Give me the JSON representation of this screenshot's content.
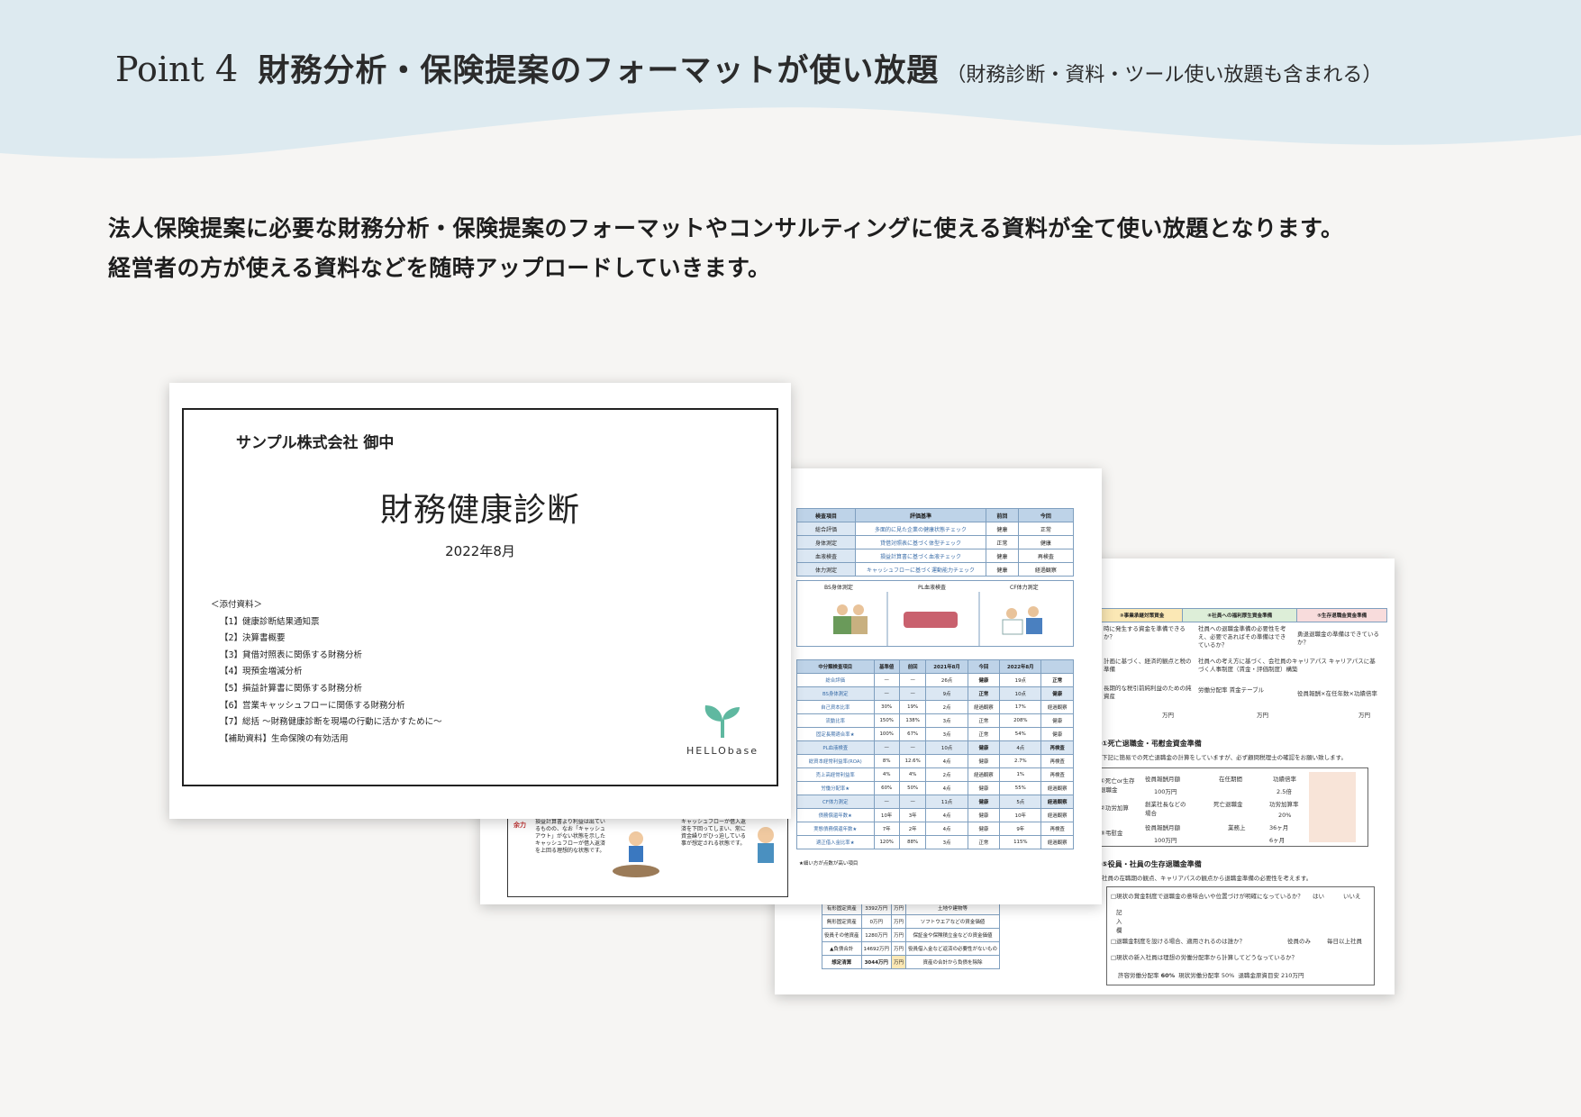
{
  "header": {
    "point_label": "Point",
    "point_number": "4",
    "headline": "財務分析・保険提案のフォーマットが使い放題",
    "subheadline": "（財務診断・資料・ツール使い放題も含まれる）"
  },
  "description": {
    "line1": "法人保険提案に必要な財務分析・保険提案のフォーマットやコンサルティングに使える資料が全て使い放題となります。",
    "line2": "経営者の方が使える資料などを随時アップロードしていきます。"
  },
  "cover": {
    "company": "サンプル株式会社 御中",
    "title": "財務健康診断",
    "date": "2022年8月",
    "attachments_heading": "＜添付資料＞",
    "attachments": [
      "【1】健康診断結果通知票",
      "【2】決算書概要",
      "【3】貸借対照表に関係する財務分析",
      "【4】現預金増減分析",
      "【5】損益計算書に関係する財務分析",
      "【6】営業キャッシュフローに関係する財務分析",
      "【7】総括 ～財務健康診断を現場の行動に活かすために～",
      "【補助資料】生命保険の有効活用"
    ],
    "logo_text": "HELLObase"
  },
  "report": {
    "table1_headers": [
      "検査項目",
      "評価基準",
      "前回",
      "今回"
    ],
    "table1_rows": [
      [
        "総合評価",
        "多面的に見た企業の健康状態チェック",
        "健康",
        "正常"
      ],
      [
        "身体測定",
        "貸借対照表に基づく体型チェック",
        "正常",
        "健康"
      ],
      [
        "血液検査",
        "損益計算書に基づく血液チェック",
        "健康",
        "再検査"
      ],
      [
        "体力測定",
        "キャッシュフローに基づく運動能力チェック",
        "健康",
        "経過観察"
      ]
    ],
    "panel_labels": [
      "BS身体測定",
      "PL血液検査",
      "CF体力測定"
    ],
    "table2_headers": [
      "中分類検査項目",
      "基準値",
      "前回",
      "2021年8月",
      "今回",
      "2022年8月"
    ],
    "table2_rows": [
      [
        "総合評価",
        "—",
        "—",
        "26点",
        "健康",
        "19点",
        "正常"
      ],
      [
        "BS身体測定",
        "—",
        "—",
        "9点",
        "正常",
        "10点",
        "健康"
      ],
      [
        "自己資本比率",
        "30%",
        "19%",
        "2点",
        "経過観察",
        "17%",
        "2点",
        "経過観察"
      ],
      [
        "流動比率",
        "150%",
        "138%",
        "3点",
        "正常",
        "208%",
        "4点",
        "健康"
      ],
      [
        "固定長期適合率★",
        "100%",
        "67%",
        "3点",
        "正常",
        "54%",
        "4点",
        "健康"
      ],
      [
        "PL血液検査",
        "—",
        "—",
        "10点",
        "健康",
        "—",
        "4点",
        "再検査"
      ],
      [
        "総資本経常利益率(ROA)",
        "8%",
        "12.6%",
        "4点",
        "健康",
        "2.7%",
        "1点",
        "再検査"
      ],
      [
        "売上高経常利益率",
        "4%",
        "4%",
        "2点",
        "経過観察",
        "1%",
        "1点",
        "再検査"
      ],
      [
        "労働分配率★",
        "60%",
        "50%",
        "4点",
        "健康",
        "55%",
        "2点",
        "経過観察"
      ],
      [
        "CF体力測定",
        "—",
        "—",
        "11点",
        "健康",
        "—",
        "5点",
        "経過観察"
      ],
      [
        "債務償還年数★",
        "10年",
        "3年",
        "4点",
        "健康",
        "10年",
        "2点",
        "経過観察"
      ],
      [
        "実態債務償還年数★",
        "7年",
        "2年",
        "4点",
        "健康",
        "9年",
        "1点",
        "再検査"
      ],
      [
        "適正借入金比率★",
        "120%",
        "88%",
        "3点",
        "正常",
        "115%",
        "2点",
        "経過観察"
      ]
    ],
    "footnote": "★細い方が点数が高い項目",
    "lower_text_1": "損益計算書より利益は出ているものの、なお「キャッシュアウト」がない状態を示したキャッシュフローが借入返済を上回る理想的な状態です。",
    "lower_text_2": "キャッシュフローが借入返済を下回ってしまい、常に資金繰りがひっ迫している事が想定される状態です。",
    "lower_side_label": "余力",
    "bottom_rows": [
      [
        "有形固定資産",
        "3392万円",
        "万円",
        "土地や建物等"
      ],
      [
        "無形固定資産",
        "0万円",
        "万円",
        "ソフトウエアなどの資金価値"
      ],
      [
        "役員その他資産",
        "1280万円",
        "万円",
        "保証金や保険積立金などの資金価値"
      ],
      [
        "▲負債合計",
        "14692万円",
        "万円",
        "役員借入金など返済の必要性がないもの"
      ],
      [
        "想定清算",
        "3044万円",
        "万円",
        "資産の合計から負債を除除"
      ]
    ]
  },
  "plan": {
    "col_headers": [
      "③事業承継対策資金",
      "④社員への福利厚生資金準備",
      "⑤生存退職金資金準備"
    ],
    "row_texts": [
      [
        "時に発生する資金を準備できるか？",
        "社員への退職金準備の必要性を考え、必要であればその準備はできているか？",
        "勇退退職金の準備はできているか？"
      ],
      [
        "計画に基づく、経済的観点と税の準備",
        "社員への考え方に基づく、会社員のキャリアパス キャリアパスに基づく人事制度（賃金・評価制度）構築",
        ""
      ],
      [
        "長期的な税引前純利益のための純資産",
        "労働分配率 賃金テーブル",
        "役員報酬×在任年数×功績倍率"
      ]
    ],
    "unit": "万円",
    "section1_title": "①死亡退職金・弔慰金資金準備",
    "section1_note": "下記に簡易での死亡退職金の計算をしていますが、必ず顧問税理士の確認をお願い致します。",
    "calc_rows": [
      [
        "①死亡or生存退職金",
        "役員報酬月額",
        "100万円",
        "在任期間",
        "功績倍率",
        "2.5倍"
      ],
      [
        "②功労加算",
        "創業社長などの場合",
        "死亡退職金",
        "功労加算率",
        "20%",
        ""
      ],
      [
        "③弔慰金",
        "役員報酬月額",
        "100万円",
        "業務上",
        "36ヶ月",
        "6ヶ月"
      ]
    ],
    "section2_title": "⑤役員・社員の生存退職金準備",
    "section2_note": "社員の在職期の観点、キャリアパスの観点から退職金準備の必要性を考えます。",
    "checks": [
      "□現状の賞金制度で退職金の意味合いや位置づけが明確になっているか？",
      "□退職金制度を設ける場合、適用されるのは誰か？",
      "□現状の新入社員は理想の労働分配率から計算してどうなっているか？"
    ],
    "yes_no": [
      "はい",
      "いいえ"
    ],
    "note_label": "記入欄",
    "who_options": [
      "役員のみ",
      "毎日以上社員"
    ],
    "bottom_line": [
      "許容労働分配率",
      "60%",
      "現状労働分配率",
      "50%",
      "退職金原資目安",
      "210万円"
    ]
  },
  "colors": {
    "hero_band": "#ddeaf0",
    "table_header": "#bed3e8",
    "cover_logo_green": "#5fb8a0",
    "highlight_yellow": "#fbe8b5",
    "highlight_pink": "#f8dcdc",
    "highlight_green": "#ddeed8"
  }
}
